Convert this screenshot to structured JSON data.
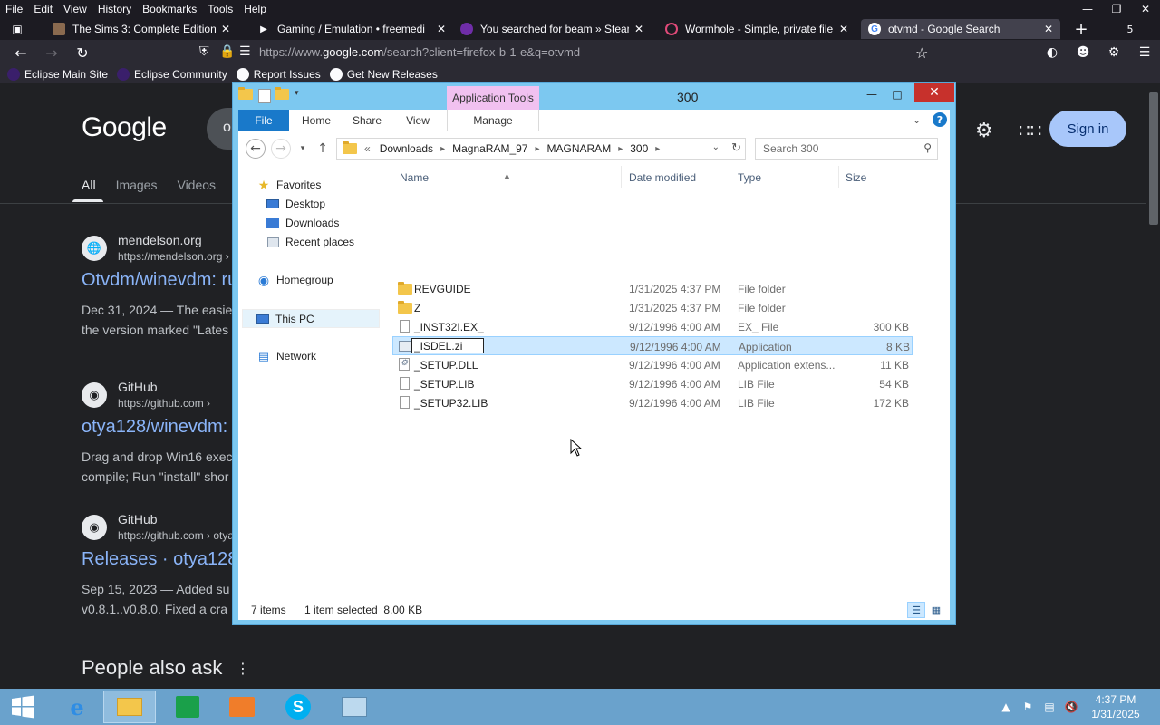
{
  "firefox": {
    "menu": [
      "File",
      "Edit",
      "View",
      "History",
      "Bookmarks",
      "Tools",
      "Help"
    ],
    "tabs": [
      {
        "label": "The Sims 3: Complete Edition -",
        "color": "#8a6a4f"
      },
      {
        "label": "Gaming / Emulation • freemedi",
        "color": "#2b2a33"
      },
      {
        "label": "You searched for beam » Steam",
        "color": "#6f2da8"
      },
      {
        "label": "Wormhole - Simple, private file",
        "color": "#e04a79"
      },
      {
        "label": "otvmd - Google Search",
        "color": "#ffffff"
      }
    ],
    "tab_count": "5",
    "url_prefix": "https://www.",
    "url_domain": "google.com",
    "url_rest": "/search?client=firefox-b-1-e&q=otvmd",
    "bookmarks": [
      "Eclipse Main Site",
      "Eclipse Community",
      "Report Issues",
      "Get New Releases"
    ]
  },
  "google": {
    "logo": "Google",
    "search_stub": "o",
    "sign_in": "Sign in",
    "tabs": [
      "All",
      "Images",
      "Videos"
    ],
    "results": [
      {
        "site": "mendelson.org",
        "url": "https://mendelson.org ›",
        "title": "Otvdm/winevdm: ru",
        "snip1": "Dec 31, 2024 — The easie",
        "snip2": "the version marked \"Lates"
      },
      {
        "site": "GitHub",
        "url": "https://github.com ›",
        "title": "otya128/winevdm:",
        "snip1": "Drag and drop Win16 exec",
        "snip2": "compile; Run \"install\" shor"
      },
      {
        "site": "GitHub",
        "url": "https://github.com › otya",
        "title": "Releases · otya128",
        "snip1": "Sep 15, 2023 — Added su",
        "snip2": "v0.8.1..v0.8.0. Fixed a cra"
      }
    ],
    "people_also_ask": "People also ask"
  },
  "explorer": {
    "title": "300",
    "context_tab": "Application Tools",
    "ribbon_tabs": [
      "File",
      "Home",
      "Share",
      "View"
    ],
    "manage": "Manage",
    "breadcrumb": [
      "«",
      "Downloads",
      "MagnaRAM_97",
      "MAGNARAM",
      "300"
    ],
    "search_placeholder": "Search 300",
    "nav": {
      "favorites": "Favorites",
      "desktop": "Desktop",
      "downloads": "Downloads",
      "recent": "Recent places",
      "homegroup": "Homegroup",
      "thispc": "This PC",
      "network": "Network"
    },
    "columns": {
      "name": "Name",
      "date": "Date modified",
      "type": "Type",
      "size": "Size"
    },
    "files": [
      {
        "name": "REVGUIDE",
        "date": "1/31/2025 4:37 PM",
        "type": "File folder",
        "size": "",
        "icon": "folder"
      },
      {
        "name": "Z",
        "date": "1/31/2025 4:37 PM",
        "type": "File folder",
        "size": "",
        "icon": "folder"
      },
      {
        "name": "_INST32I.EX_",
        "date": "9/12/1996 4:00 AM",
        "type": "EX_ File",
        "size": "300 KB",
        "icon": "file"
      },
      {
        "name": "_ISDEL.zi",
        "date": "9/12/1996 4:00 AM",
        "type": "Application",
        "size": "8 KB",
        "icon": "exe"
      },
      {
        "name": "_SETUP.DLL",
        "date": "9/12/1996 4:00 AM",
        "type": "Application extens...",
        "size": "11 KB",
        "icon": "dll"
      },
      {
        "name": "_SETUP.LIB",
        "date": "9/12/1996 4:00 AM",
        "type": "LIB File",
        "size": "54 KB",
        "icon": "file"
      },
      {
        "name": "_SETUP32.LIB",
        "date": "9/12/1996 4:00 AM",
        "type": "LIB File",
        "size": "172 KB",
        "icon": "file"
      }
    ],
    "rename_value": "_ISDEL.zi",
    "status": {
      "items": "7 items",
      "selected": "1 item selected  8.00 KB"
    }
  },
  "taskbar": {
    "time": "4:37 PM",
    "date": "1/31/2025"
  }
}
